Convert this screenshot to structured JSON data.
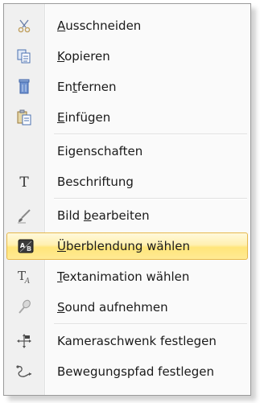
{
  "menu": {
    "groups": [
      [
        {
          "id": "ausschneiden",
          "label": "Ausschneiden",
          "accel": "A",
          "rest": "usschneiden",
          "pre": "",
          "icon": "scissors-icon"
        },
        {
          "id": "kopieren",
          "label": "Kopieren",
          "accel": "K",
          "rest": "opieren",
          "pre": "",
          "icon": "copy-icon"
        },
        {
          "id": "entfernen",
          "label": "Entfernen",
          "accel": "t",
          "rest": "fernen",
          "pre": "En",
          "icon": "delete-icon"
        },
        {
          "id": "einfuegen",
          "label": "Einfügen",
          "accel": "E",
          "rest": "infügen",
          "pre": "",
          "icon": "paste-icon"
        }
      ],
      [
        {
          "id": "eigenschaften",
          "label": "Eigenschaften",
          "icon": ""
        },
        {
          "id": "beschriftung",
          "label": "Beschriftung",
          "icon": "text-icon"
        }
      ],
      [
        {
          "id": "bild-bearbeiten",
          "label": "Bild bearbeiten",
          "pre": "Bild ",
          "accel": "b",
          "rest": "earbeiten",
          "icon": "brush-icon"
        },
        {
          "id": "ueberblendung",
          "label": "Überblendung wählen",
          "pre": "",
          "accel": "Ü",
          "rest": "berblendung wählen",
          "icon": "transition-icon",
          "highlighted": true
        },
        {
          "id": "textanimation",
          "label": "Textanimation wählen",
          "pre": "",
          "accel": "T",
          "rest": "extanimation wählen",
          "icon": "text-animation-icon"
        },
        {
          "id": "sound",
          "label": "Sound aufnehmen",
          "pre": "",
          "accel": "S",
          "rest": "ound aufnehmen",
          "icon": "microphone-icon"
        }
      ],
      [
        {
          "id": "kameraschwenk",
          "label": "Kameraschwenk festlegen",
          "icon": "camera-pan-icon"
        },
        {
          "id": "bewegungspfad",
          "label": "Bewegungspfad festlegen",
          "icon": "motion-path-icon"
        }
      ]
    ],
    "colors": {
      "highlight_border": "#e6b84c",
      "highlight_fill": "#ffe57a"
    }
  }
}
